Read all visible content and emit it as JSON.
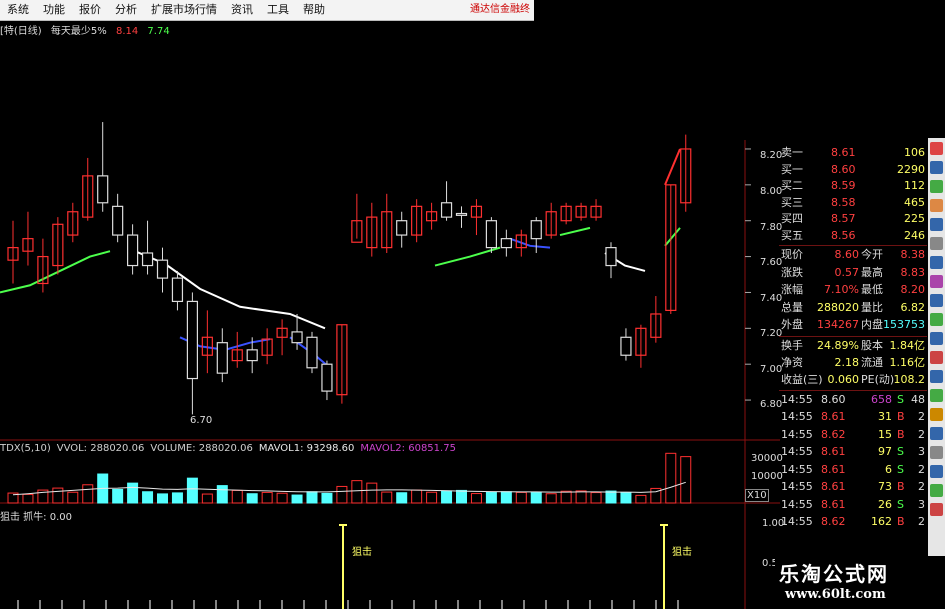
{
  "menu": {
    "items": [
      "系统",
      "功能",
      "报价",
      "分析",
      "扩展市场行情",
      "资讯",
      "工具",
      "帮助"
    ],
    "ad_text": "通达信金融终"
  },
  "info": {
    "name": "[特(日线)",
    "rule": "每天最少5%",
    "v1": "8.14",
    "v2": "7.74"
  },
  "axis": {
    "price_ticks": [
      "8.20",
      "8.00",
      "7.80",
      "7.60",
      "7.40",
      "7.20",
      "7.00",
      "6.80"
    ],
    "vol_ticks": [
      "30000",
      "10000",
      "X10"
    ],
    "ind_ticks": [
      "1.00",
      "0.50"
    ]
  },
  "labels": {
    "low_mark": "6.70",
    "vol_header": "TDX(5,10)  VVOL: 288020.06  VOLUME: 288020.06  MAVOL1: 93298.60  MAVOL2: 60851.75",
    "vol_parts": [
      {
        "t": "TDX(5,10)",
        "c": "#d0d0d0"
      },
      {
        "t": "VVOL: 288020.06",
        "c": "#d0d0d0"
      },
      {
        "t": "VOLUME: 288020.06",
        "c": "#d0d0d0"
      },
      {
        "t": "MAVOL1: 93298.60",
        "c": "#e8e8e8"
      },
      {
        "t": "MAVOL2: 60851.75",
        "c": "#cc44cc"
      }
    ],
    "ind_header": "狙击  抓牛: 0.00",
    "signal": "狙击"
  },
  "colors": {
    "up": "#ff3030",
    "down": "#54ffff",
    "ma_green": "#4cff4c",
    "ma_white": "#ffffff",
    "ma_blue": "#3a52ff",
    "grid": "#8a1010",
    "signal": "#ffff66"
  },
  "quote": {
    "book": [
      {
        "label": "卖一",
        "price": "8.61",
        "vol": "106"
      },
      {
        "label": "买一",
        "price": "8.60",
        "vol": "2290"
      },
      {
        "label": "买二",
        "price": "8.59",
        "vol": "112"
      },
      {
        "label": "买三",
        "price": "8.58",
        "vol": "465"
      },
      {
        "label": "买四",
        "price": "8.57",
        "vol": "225"
      },
      {
        "label": "买五",
        "price": "8.56",
        "vol": "246"
      }
    ],
    "stats": [
      {
        "l1": "现价",
        "v1": "8.60",
        "l2": "今开",
        "v2": "8.38"
      },
      {
        "l1": "涨跌",
        "v1": "0.57",
        "l2": "最高",
        "v2": "8.83"
      },
      {
        "l1": "涨幅",
        "v1": "7.10%",
        "l2": "最低",
        "v2": "8.20"
      },
      {
        "l1": "总量",
        "v1": "288020",
        "l2": "量比",
        "v2": "6.82"
      },
      {
        "l1": "外盘",
        "v1": "134267",
        "l2": "内盘",
        "v2": "153753"
      }
    ],
    "stats2": [
      {
        "l1": "换手",
        "v1": "24.89%",
        "l2": "股本",
        "v2": "1.84亿"
      },
      {
        "l1": "净资",
        "v1": "2.18",
        "l2": "流通",
        "v2": "1.16亿"
      },
      {
        "l1": "收益(三)",
        "v1": "0.060",
        "l2": "PE(动)",
        "v2": "108.2"
      }
    ],
    "ticks": [
      {
        "t": "14:55",
        "p": "8.60",
        "v": "658",
        "s": "S"
      },
      {
        "t": "14:55",
        "p": "8.61",
        "v": "31",
        "s": "B"
      },
      {
        "t": "14:55",
        "p": "8.62",
        "v": "15",
        "s": "B"
      },
      {
        "t": "14:55",
        "p": "8.61",
        "v": "97",
        "s": "S"
      },
      {
        "t": "14:55",
        "p": "8.61",
        "v": "6",
        "s": "S"
      },
      {
        "t": "14:55",
        "p": "8.61",
        "v": "73",
        "s": "B"
      },
      {
        "t": "14:55",
        "p": "8.61",
        "v": "26",
        "s": "S"
      },
      {
        "t": "14:55",
        "p": "8.62",
        "v": "162",
        "s": "B"
      }
    ],
    "tick_extra": [
      "48",
      "2",
      "2",
      "3",
      "2",
      "2",
      "3",
      "2"
    ]
  },
  "watermark": {
    "title": "乐淘公式网",
    "url": "www.60lt.com"
  },
  "sidebar_icons": [
    "chart-icon",
    "line-icon",
    "compare-icon",
    "trend-icon",
    "info-icon",
    "list-icon",
    "grid-icon",
    "stats-icon",
    "table-icon",
    "bars-icon",
    "signal-icon",
    "wave-icon",
    "rsi-icon",
    "up-icon",
    "edit-icon",
    "dot-icon",
    "gear-icon",
    "sum-icon",
    "flag-icon",
    "star-icon"
  ],
  "chart_data": {
    "type": "candlestick",
    "price_axis": {
      "min": 6.7,
      "max": 8.25
    },
    "candles": [
      {
        "o": 7.58,
        "c": 7.65,
        "h": 7.8,
        "l": 7.45
      },
      {
        "o": 7.63,
        "c": 7.7,
        "h": 7.85,
        "l": 7.55
      },
      {
        "o": 7.45,
        "c": 7.6,
        "h": 7.7,
        "l": 7.4
      },
      {
        "o": 7.55,
        "c": 7.78,
        "h": 7.82,
        "l": 7.5
      },
      {
        "o": 7.72,
        "c": 7.85,
        "h": 7.9,
        "l": 7.68
      },
      {
        "o": 7.82,
        "c": 8.05,
        "h": 8.15,
        "l": 7.8
      },
      {
        "o": 8.05,
        "c": 7.9,
        "h": 8.35,
        "l": 7.85
      },
      {
        "o": 7.88,
        "c": 7.72,
        "h": 7.95,
        "l": 7.68
      },
      {
        "o": 7.72,
        "c": 7.55,
        "h": 7.78,
        "l": 7.5
      },
      {
        "o": 7.62,
        "c": 7.55,
        "h": 7.8,
        "l": 7.5
      },
      {
        "o": 7.58,
        "c": 7.48,
        "h": 7.65,
        "l": 7.4
      },
      {
        "o": 7.48,
        "c": 7.35,
        "h": 7.52,
        "l": 7.3
      },
      {
        "o": 7.35,
        "c": 6.92,
        "h": 7.4,
        "l": 6.72
      },
      {
        "o": 7.05,
        "c": 7.15,
        "h": 7.3,
        "l": 6.95
      },
      {
        "o": 7.12,
        "c": 6.95,
        "h": 7.2,
        "l": 6.9
      },
      {
        "o": 7.02,
        "c": 7.08,
        "h": 7.18,
        "l": 6.98
      },
      {
        "o": 7.08,
        "c": 7.02,
        "h": 7.15,
        "l": 6.95
      },
      {
        "o": 7.05,
        "c": 7.14,
        "h": 7.2,
        "l": 7.0
      },
      {
        "o": 7.15,
        "c": 7.2,
        "h": 7.25,
        "l": 7.05
      },
      {
        "o": 7.18,
        "c": 7.12,
        "h": 7.28,
        "l": 7.08
      },
      {
        "o": 7.15,
        "c": 6.98,
        "h": 7.18,
        "l": 6.95
      },
      {
        "o": 7.0,
        "c": 6.85,
        "h": 7.02,
        "l": 6.8
      },
      {
        "o": 6.83,
        "c": 7.22,
        "h": 7.22,
        "l": 6.78
      },
      {
        "o": 7.68,
        "c": 7.8,
        "h": 7.95,
        "l": 7.7
      },
      {
        "o": 7.65,
        "c": 7.82,
        "h": 7.9,
        "l": 7.6
      },
      {
        "o": 7.65,
        "c": 7.85,
        "h": 7.95,
        "l": 7.62
      },
      {
        "o": 7.8,
        "c": 7.72,
        "h": 7.85,
        "l": 7.65
      },
      {
        "o": 7.72,
        "c": 7.88,
        "h": 7.92,
        "l": 7.68
      },
      {
        "o": 7.8,
        "c": 7.85,
        "h": 7.9,
        "l": 7.75
      },
      {
        "o": 7.9,
        "c": 7.82,
        "h": 8.02,
        "l": 7.8
      },
      {
        "o": 7.84,
        "c": 7.83,
        "h": 7.88,
        "l": 7.76
      },
      {
        "o": 7.82,
        "c": 7.88,
        "h": 7.92,
        "l": 7.72
      },
      {
        "o": 7.8,
        "c": 7.65,
        "h": 7.82,
        "l": 7.62
      },
      {
        "o": 7.7,
        "c": 7.65,
        "h": 7.75,
        "l": 7.6
      },
      {
        "o": 7.65,
        "c": 7.72,
        "h": 7.75,
        "l": 7.6
      },
      {
        "o": 7.8,
        "c": 7.7,
        "h": 7.82,
        "l": 7.62
      },
      {
        "o": 7.72,
        "c": 7.85,
        "h": 7.9,
        "l": 7.7
      },
      {
        "o": 7.8,
        "c": 7.88,
        "h": 7.9,
        "l": 7.78
      },
      {
        "o": 7.82,
        "c": 7.88,
        "h": 7.9,
        "l": 7.8
      },
      {
        "o": 7.82,
        "c": 7.88,
        "h": 7.92,
        "l": 7.8
      },
      {
        "o": 7.65,
        "c": 7.55,
        "h": 7.68,
        "l": 7.48
      },
      {
        "o": 7.15,
        "c": 7.05,
        "h": 7.2,
        "l": 7.02
      },
      {
        "o": 7.05,
        "c": 7.2,
        "h": 7.22,
        "l": 6.98
      },
      {
        "o": 7.15,
        "c": 7.28,
        "h": 7.38,
        "l": 7.12
      },
      {
        "o": 7.3,
        "c": 8.0,
        "h": 8.0,
        "l": 7.28
      },
      {
        "o": 7.9,
        "c": 8.2,
        "h": 8.28,
        "l": 7.85
      }
    ],
    "ma_green": [
      7.38,
      7.4,
      7.42,
      7.44,
      7.47,
      7.5,
      7.54,
      7.58,
      7.62,
      7.63
    ],
    "ma_white": [
      7.63,
      7.6,
      7.55,
      7.47,
      7.38,
      7.3,
      7.25,
      7.23,
      7.2,
      7.15
    ],
    "volume": [
      6000,
      5200,
      7800,
      9000,
      6500,
      11000,
      17500,
      8200,
      12000,
      6800,
      5500,
      6100,
      15000,
      5400,
      10500,
      7600,
      5600,
      6400,
      5900,
      4800,
      6800,
      5800,
      10000,
      13500,
      12000,
      6600,
      6200,
      7800,
      6500,
      7300,
      7600,
      5700,
      6600,
      6800,
      6400,
      6600,
      5600,
      7100,
      7300,
      6300,
      7200,
      6200,
      4600,
      8800,
      30000,
      28000
    ]
  }
}
